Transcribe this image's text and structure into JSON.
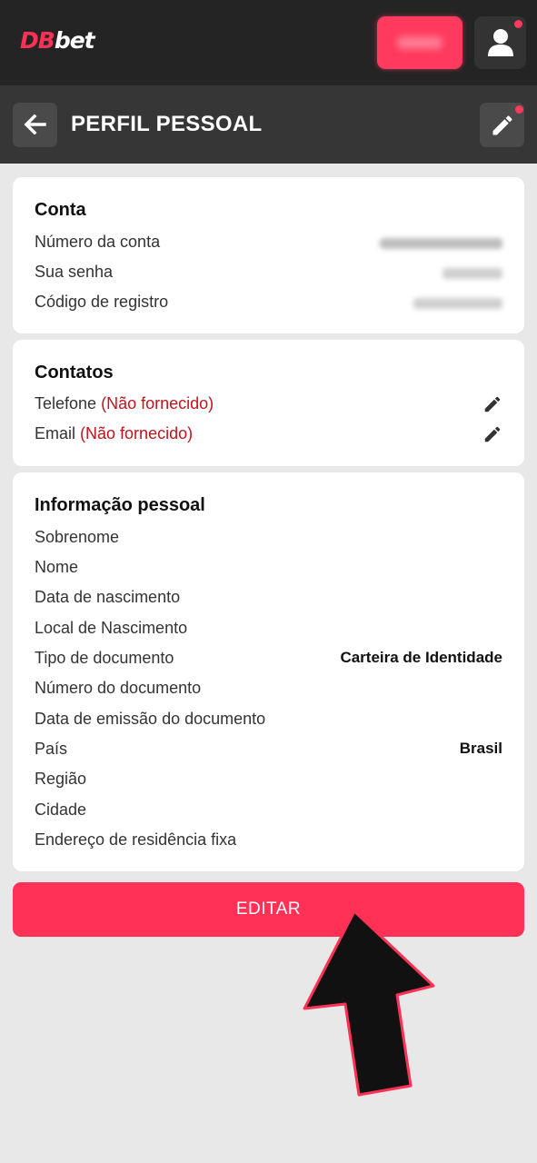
{
  "header": {
    "logo_part1": "DB",
    "logo_part2": "bet"
  },
  "subheader": {
    "title": "PERFIL PESSOAL"
  },
  "account": {
    "title": "Conta",
    "rows": [
      {
        "label": "Número da conta"
      },
      {
        "label": "Sua senha"
      },
      {
        "label": "Código de registro"
      }
    ]
  },
  "contacts": {
    "title": "Contatos",
    "rows": [
      {
        "label": "Telefone",
        "status": "(Não fornecido)"
      },
      {
        "label": "Email",
        "status": "(Não fornecido)"
      }
    ]
  },
  "personal": {
    "title": "Informação pessoal",
    "rows": [
      {
        "label": "Sobrenome",
        "value": ""
      },
      {
        "label": "Nome",
        "value": ""
      },
      {
        "label": "Data de nascimento",
        "value": ""
      },
      {
        "label": "Local de Nascimento",
        "value": ""
      },
      {
        "label": "Tipo de documento",
        "value": "Carteira de Identidade"
      },
      {
        "label": "Número do documento",
        "value": ""
      },
      {
        "label": "Data de emissão do documento",
        "value": ""
      },
      {
        "label": "País",
        "value": "Brasil"
      },
      {
        "label": "Região",
        "value": ""
      },
      {
        "label": "Cidade",
        "value": ""
      },
      {
        "label": "Endereço de residência fixa",
        "value": ""
      }
    ]
  },
  "actions": {
    "edit_label": "EDITAR"
  },
  "colors": {
    "accent": "#ff3156",
    "topbar": "#242424",
    "subbar": "#363636",
    "not_provided": "#c0141a"
  },
  "icons": {
    "back": "arrow-left-icon",
    "user": "user-icon",
    "edit": "pencil-icon",
    "pointer": "arrow-pointer-icon"
  }
}
